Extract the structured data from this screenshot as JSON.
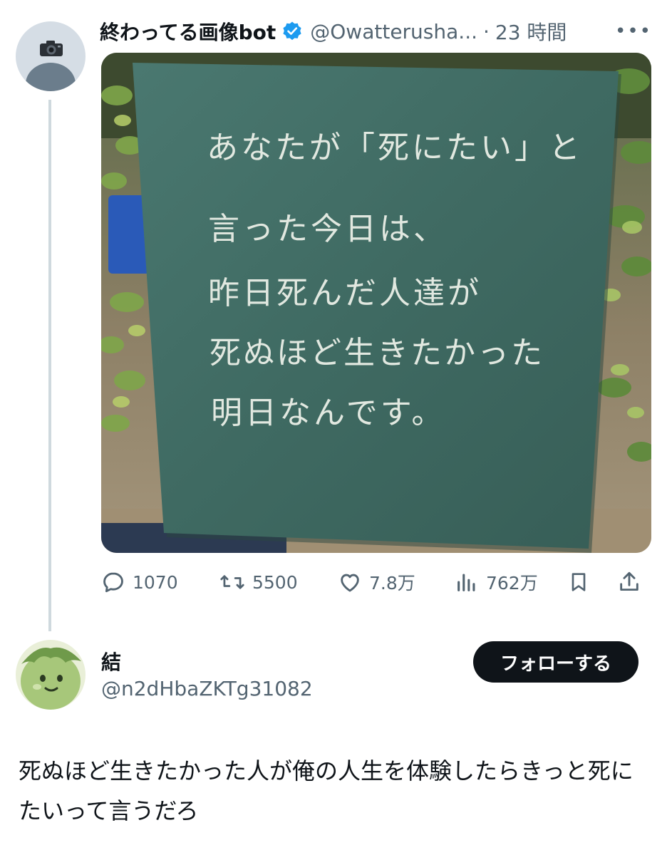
{
  "tweet": {
    "display_name": "終わってる画像bot",
    "handle": "@Owatterusha...",
    "separator": "·",
    "time": "23 時間",
    "more_label": "•••",
    "avatar_icon": "camera-icon",
    "media": {
      "board_text_lines": [
        "あなたが「死にたい」と",
        "言った今日は、",
        "昨日死んだ人達が",
        "死ぬほど生きたかった",
        "明日なんです。"
      ]
    },
    "stats": {
      "replies": "1070",
      "retweets": "5500",
      "likes": "7.8万",
      "views": "762万"
    }
  },
  "reply_user": {
    "display_name": "結",
    "handle": "@n2dHbaZKTg31082",
    "follow_label": "フォローする",
    "text": "死ぬほど生きたかった人が俺の人生を体験したらきっと死にたいって言うだろ"
  },
  "colors": {
    "text_primary": "#0f1419",
    "text_secondary": "#536471",
    "verified_blue": "#1d9bf0",
    "chalkboard": "#3f6a62",
    "thread_line": "#cfd9de"
  }
}
